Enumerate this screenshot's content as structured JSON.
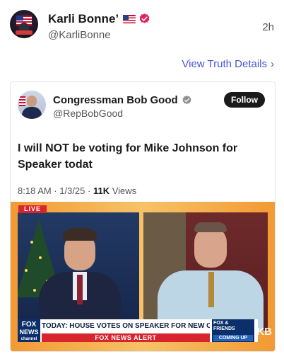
{
  "post": {
    "display_name": "Karli Bonne’",
    "handle": "@KarliBonne",
    "time": "2h",
    "details_link": "View Truth Details",
    "details_chevron": "›"
  },
  "embed": {
    "name": "Congressman Bob Good",
    "handle": "@RepBobGood",
    "follow_label": "Follow",
    "text": "I will NOT be voting for Mike Johnson for Speaker todat",
    "time": "8:18 AM · 1/3/25 · ",
    "views": "11K",
    "views_label": " Views"
  },
  "video": {
    "live_label": "LIVE",
    "fox_logo_line1": "FOX",
    "fox_logo_line2": "NEWS",
    "fox_logo_line3": "channel",
    "headline": "TODAY: HOUSE VOTES ON SPEAKER FOR NEW CONGRESS",
    "alert": "FOX NEWS ALERT",
    "friends_line1": "FOX &",
    "friends_line2": "FRIENDS",
    "coming_up": "COMING UP",
    "watermark": "KB"
  },
  "colors": {
    "link": "#4a54d6",
    "verified": "#e0245e",
    "alert_red": "#d8252d",
    "fox_blue": "#0b2f6b"
  }
}
